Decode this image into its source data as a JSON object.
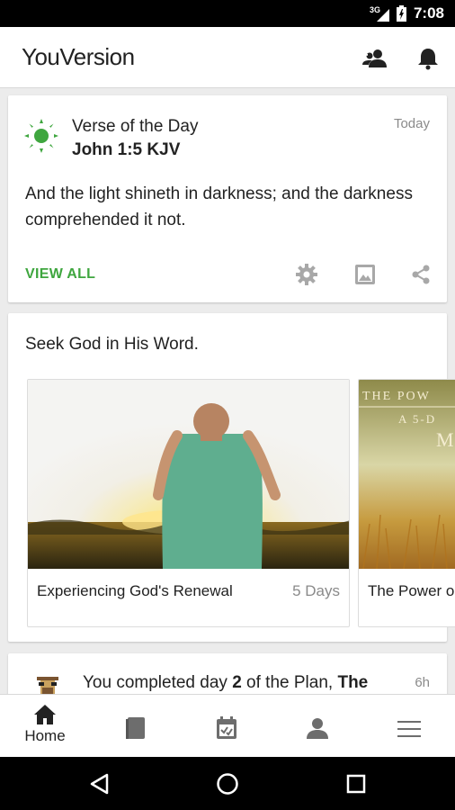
{
  "status_bar": {
    "network": "3G",
    "time": "7:08"
  },
  "app_bar": {
    "title": "YouVersion",
    "icons": [
      "friends-icon",
      "notifications-icon"
    ]
  },
  "verse_of_the_day": {
    "label": "Verse of the Day",
    "reference": "John 1:5 KJV",
    "date": "Today",
    "text": "And the light shineth in darkness; and the darkness comprehended it not.",
    "view_all_label": "VIEW ALL",
    "accent_color": "#3fa63f",
    "actions": [
      "settings-icon",
      "image-icon",
      "share-icon"
    ]
  },
  "plans": {
    "heading": "Seek God in His Word.",
    "items": [
      {
        "title": "Experiencing God's Renewal",
        "duration": "5 Days"
      },
      {
        "title": "The Power o",
        "image_text": "THE POW",
        "image_subtext": "A 5-D",
        "image_letter": "M"
      }
    ]
  },
  "activity": {
    "prefix": "You completed day ",
    "day": "2",
    "middle": " of the Plan, ",
    "plan": "The",
    "time": "6h"
  },
  "bottom_nav": {
    "items": [
      {
        "label": "Home",
        "icon": "home-icon",
        "active": true
      },
      {
        "label": "",
        "icon": "bible-icon"
      },
      {
        "label": "",
        "icon": "plans-icon"
      },
      {
        "label": "",
        "icon": "profile-icon"
      },
      {
        "label": "",
        "icon": "menu-icon"
      }
    ]
  },
  "system_nav": {
    "buttons": [
      "back-icon",
      "home-circle-icon",
      "recents-icon"
    ]
  }
}
